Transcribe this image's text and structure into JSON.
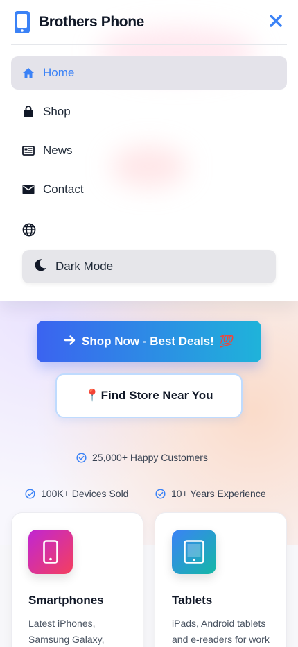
{
  "brand": {
    "name": "Brothers Phone",
    "icon": "smartphone-icon",
    "accent": "#3b82f6"
  },
  "drawer": {
    "close_icon": "close-icon",
    "items": [
      {
        "label": "Home",
        "icon": "home-icon",
        "active": true
      },
      {
        "label": "Shop",
        "icon": "shopping-bag-icon",
        "active": false
      },
      {
        "label": "News",
        "icon": "newspaper-icon",
        "active": false
      },
      {
        "label": "Contact",
        "icon": "envelope-icon",
        "active": false
      }
    ],
    "language_icon": "globe-icon",
    "dark_mode": {
      "label": "Dark Mode",
      "icon": "moon-icon"
    }
  },
  "hero": {
    "primary_cta": {
      "label": "Shop Now - Best Deals!",
      "emoji": "💯",
      "icon": "arrow-right-icon"
    },
    "secondary_cta": {
      "label": "Find Store Near You",
      "emoji": "📍"
    }
  },
  "stats": [
    {
      "text": "25,000+ Happy Customers",
      "icon": "check-circle-icon"
    },
    {
      "text": "100K+ Devices Sold",
      "icon": "check-circle-icon"
    },
    {
      "text": "10+ Years Experience",
      "icon": "check-circle-icon"
    }
  ],
  "categories": [
    {
      "title": "Smartphones",
      "description": "Latest iPhones, Samsung Galaxy, Google Pixel and",
      "icon": "smartphone-icon",
      "gradient": [
        "#c026d3",
        "#f43f5e"
      ]
    },
    {
      "title": "Tablets",
      "description": "iPads, Android tablets and e-readers for work",
      "icon": "tablet-icon",
      "gradient": [
        "#3b82f6",
        "#14b8a6"
      ]
    }
  ]
}
